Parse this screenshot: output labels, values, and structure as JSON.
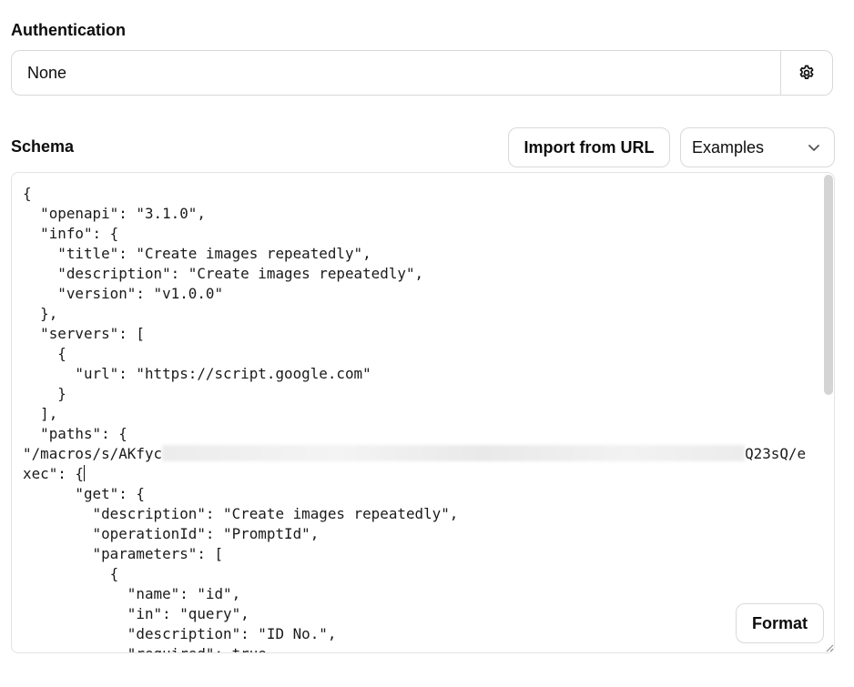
{
  "authentication": {
    "label": "Authentication",
    "value": "None",
    "settings_icon": "gear-icon"
  },
  "schema": {
    "label": "Schema",
    "import_button": "Import from URL",
    "examples_select": {
      "selected": "Examples",
      "icon": "chevron-down-icon"
    },
    "format_button": "Format",
    "code_before_redaction": "{\n  \"openapi\": \"3.1.0\",\n  \"info\": {\n    \"title\": \"Create images repeatedly\",\n    \"description\": \"Create images repeatedly\",\n    \"version\": \"v1.0.0\"\n  },\n  \"servers\": [\n    {\n      \"url\": \"https://script.google.com\"\n    }\n  ],\n  \"paths\": {\n\"/macros/s/AKfyc",
    "code_after_redaction": "Q23sQ/e\nxec\": {",
    "code_rest": "\n      \"get\": {\n        \"description\": \"Create images repeatedly\",\n        \"operationId\": \"PromptId\",\n        \"parameters\": [\n          {\n            \"name\": \"id\",\n            \"in\": \"query\",\n            \"description\": \"ID No.\",\n            \"required\": true,"
  }
}
